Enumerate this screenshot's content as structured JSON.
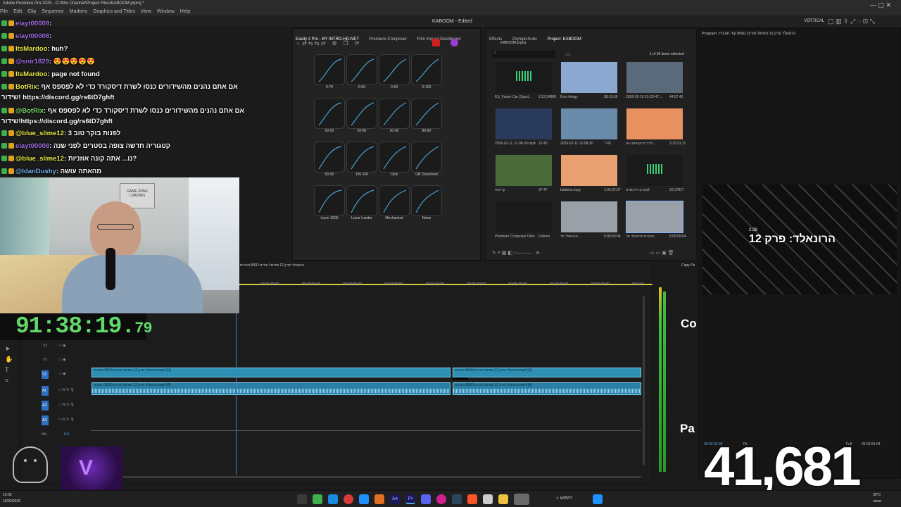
{
  "window": {
    "title": "Adobe Premiere Pro 2025 - D:\\Sho Channel\\Project Files\\KABOOM.prproj *",
    "doc_title": "KABOOM - Edited",
    "workspace": "VERTICAL",
    "menu": [
      "File",
      "Edit",
      "Clip",
      "Sequence",
      "Markers",
      "Graphics and Titles",
      "View",
      "Window",
      "Help"
    ]
  },
  "chat": [
    {
      "user": "elayt00008",
      "message": ": ",
      "color": "#a070e0"
    },
    {
      "user": "elayt00008",
      "message": ": ",
      "color": "#a070e0"
    },
    {
      "user": "ItsMardoo",
      "message": ": huh?",
      "color": "#e8e84a"
    },
    {
      "user": "@snir1829",
      "message": ": 😍😍😍😍😍",
      "color": "#a070e0"
    },
    {
      "user": "ItsMardoo",
      "message": ": page not found",
      "color": "#e8e84a"
    },
    {
      "user": "BotRix",
      "message": ": אם אתם נהנים מהשידורים כנסו לשרת דיסקורד כדי לא לפספס אף",
      "color": "#e8e84a"
    },
    {
      "user": "",
      "message": "שידור! https://discord.gg/rs6tD7ghft",
      "color": "#ffffff"
    },
    {
      "user": "@BotRix",
      "message": ": אם אתם נהנים מהשידורים כנסו לשרת דיסקורד כדי לא לפספס אף",
      "color": "#7ee070"
    },
    {
      "user": "",
      "message": "שידור!https://discord.gg/rs6tD7ghft",
      "color": "#ffffff"
    },
    {
      "user": "@blue_slime12",
      "message": ": לפנות בוקר טוב 3",
      "color": "#e8e84a"
    },
    {
      "user": "elayt00008",
      "message": ": קטגוריה חדשה צופה בסטרים לפני שנה",
      "color": "#a070e0"
    },
    {
      "user": "@blue_slime12",
      "message": ": נו... אתה קונה אוזניות?",
      "color": "#e8e84a"
    },
    {
      "user": "@IdanDushy",
      "message": ": מהאתה עושה",
      "color": "#70b0f0"
    }
  ],
  "webcam": {
    "sign": "GAME ZONE",
    "sign_sub": "LOADING"
  },
  "timer": {
    "main": "91:38:19.",
    "fraction": "79"
  },
  "curves_panel": {
    "tabs": [
      "Easily 2 Pro - BY INTRO-HD.NET",
      "Premiere Composer",
      "Film Impact Dashboard"
    ],
    "presets": [
      "0-70",
      "0-80",
      "0-90",
      "0-100",
      "50-50",
      "50-80",
      "50-90",
      "80-80",
      "90-90",
      "100-100",
      "Cliok",
      "GB Overshoot",
      "Lever 2000",
      "Lunar Lander",
      "Mechanical",
      "Noise"
    ]
  },
  "project_panel": {
    "tabs": [
      "Effects",
      "OlympicSubs",
      "Project: KABOOM"
    ],
    "file": "KABOOM.prproj",
    "items_selected": "1 of 36 items selected",
    "items": [
      {
        "name": "ES_Faster Car (Sped...",
        "duration": "3:12:24980"
      },
      {
        "name": "Emx thingy",
        "duration": "38:19:36"
      },
      {
        "name": "2026-02-10 21-23-47....",
        "duration": "44:57:40"
      },
      {
        "name": "2026-02-11 12-08-30.mp4",
        "duration": "22:43"
      },
      {
        "name": "2026-02-11 12-08-30",
        "duration": "7:45"
      },
      {
        "name": "ליבל מייקראפט ווה...",
        "duration": "2:10:31:11"
      },
      {
        "name": "קריפות",
        "duration": "37:47"
      },
      {
        "name": "baldsho.mpg",
        "duration": "1:05:22:07"
      },
      {
        "name": "קרית שורט.mp3",
        "duration": "22:37827"
      },
      {
        "name": "Premiere Composer Files",
        "duration": "0 items"
      },
      {
        "name": "הרונאלד פר...",
        "duration": "5:06:59:04"
      },
      {
        "name": "תוכנית הרונאלד פר...",
        "duration": "5:06:59:04"
      }
    ]
  },
  "program": {
    "title": "Program: קוד תוכנית MSO הרונאלד פרק 12 ספישל פורים",
    "overlay_text": "הרונאלד: פרק 12",
    "overlay_small": "2:28",
    "copy_label": "Copy Pa",
    "side_text_1": "Co",
    "side_text_2": "Pa",
    "timecode_left": "00:02:00:05",
    "timecode_right": "05:06:59:04",
    "fit": "Fit",
    "quality": "Full"
  },
  "timeline": {
    "sequence_tab": "תוכנית MSO הרונאלד פרק 12 ספישל פורים",
    "ruler": [
      "00:02:30:00",
      "00:03:00:00",
      "00:03:30:00",
      "00:04:00:00",
      "00:04:30:00",
      "00:05:00:00",
      "00:05:30:00",
      "00:06:00:00",
      "00:06:30:00",
      "00:07:0"
    ],
    "tracks": [
      "V3",
      "V2",
      "V1",
      "A1",
      "A2",
      "A3",
      "Mix"
    ],
    "mix_value": "0.0",
    "clip_v1": "תוכנית MSO הרונאלד פרק 12 ספישל פורים.mp4 [V]",
    "clip_a1": "תוכנית MSO הרונאלד פרק 12 ספישל פורים.mp4 [A]",
    "clip_v1b": "תוכנית MSO הרונאלד פרק 12 ספישל פורים.mp4 [V]",
    "clip_a1b": "תוכנית MSO הרונאלד פרק 12 ספישל פורים.mp4 [A]",
    "meter_scale": [
      "0",
      "-6",
      "-12",
      "-18",
      "-24",
      "-30",
      "-36",
      "-42",
      "-48",
      "-54"
    ]
  },
  "counter": {
    "value": "41,681"
  },
  "taskbar": {
    "search_placeholder": "חיפוש",
    "time": "10:03",
    "date": "16/02/2026",
    "weather": "30°C",
    "weather_desc": "שמשי"
  }
}
